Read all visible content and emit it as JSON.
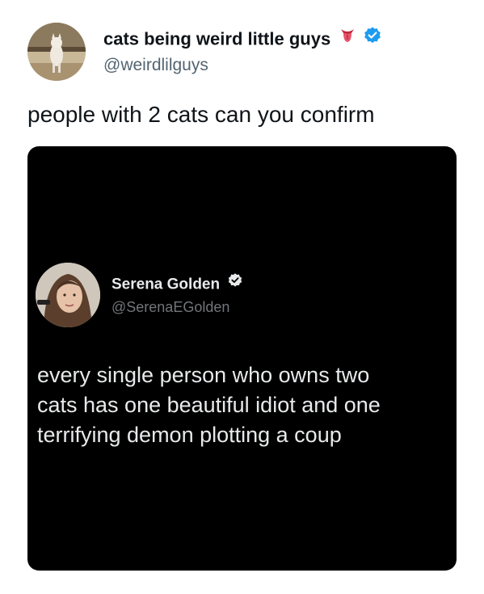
{
  "author": {
    "display_name": "cats being weird little guys",
    "emoji_icon": "tongue-emoji-icon",
    "verified_icon": "verified-badge-icon",
    "handle": "@weirdlilguys"
  },
  "tweet": {
    "text": "people with 2 cats can you confirm"
  },
  "quoted_tweet": {
    "display_name": "Serena Golden",
    "verified_icon": "verified-badge-icon",
    "handle": "@SerenaEGolden",
    "lines": [
      "every single person who owns two",
      "cats has one beautiful idiot and one",
      "terrifying demon plotting a coup"
    ]
  },
  "colors": {
    "verified_blue": "#1d9bf0",
    "text_primary": "#0f1419",
    "text_secondary": "#536471",
    "embed_background": "#000000",
    "embed_text": "#e7e9ea",
    "embed_secondary": "#71767b"
  }
}
